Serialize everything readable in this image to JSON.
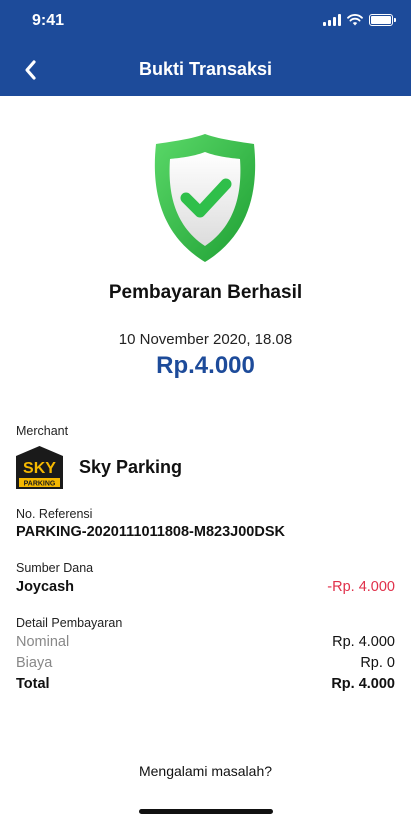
{
  "status_bar": {
    "time": "9:41"
  },
  "header": {
    "title": "Bukti Transaksi"
  },
  "result": {
    "title": "Pembayaran Berhasil",
    "datetime": "10 November 2020, 18.08",
    "amount": "Rp.4.000"
  },
  "merchant": {
    "label": "Merchant",
    "name": "Sky Parking",
    "logo_text_top": "SKY",
    "logo_text_bottom": "PARKING"
  },
  "reference": {
    "label": "No. Referensi",
    "value": "PARKING-2020111011808-M823J00DSK"
  },
  "funding": {
    "label": "Sumber Dana",
    "source": "Joycash",
    "amount": "-Rp. 4.000"
  },
  "payment_detail": {
    "label": "Detail Pembayaran",
    "rows": [
      {
        "label": "Nominal",
        "value": "Rp. 4.000"
      },
      {
        "label": "Biaya",
        "value": "Rp. 0"
      },
      {
        "label": "Total",
        "value": "Rp. 4.000"
      }
    ]
  },
  "help_link": "Mengalami masalah?",
  "colors": {
    "primary": "#1d4b9a",
    "success": "#2fbf4a",
    "negative": "#e0304a"
  },
  "icons": [
    "back-chevron-icon",
    "signal-icon",
    "wifi-icon",
    "battery-icon",
    "success-shield-icon",
    "sky-parking-logo"
  ]
}
